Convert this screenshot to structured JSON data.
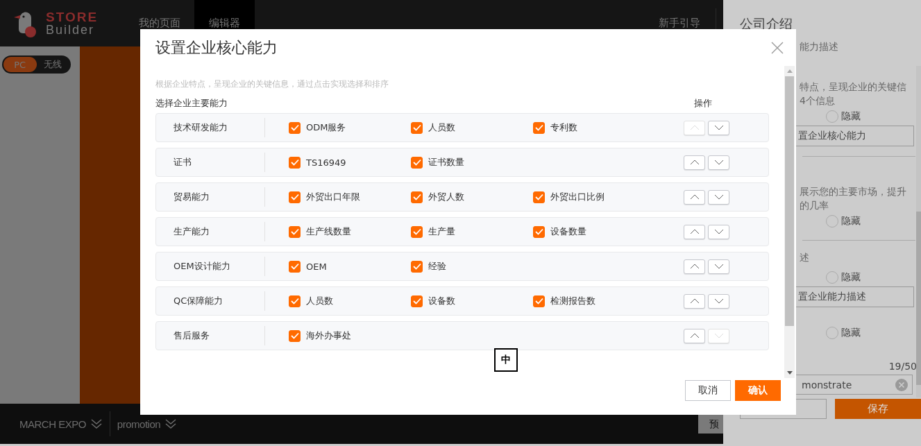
{
  "header": {
    "logo": {
      "line_1": "STORE",
      "line_2": "Builder"
    },
    "nav": [
      {
        "label": "我的页面",
        "selected": false
      },
      {
        "label": "编辑器",
        "selected": true
      }
    ],
    "guide": "新手引导"
  },
  "device_toggle": [
    {
      "label": "PC",
      "selected": true
    },
    {
      "label": "无线",
      "selected": false
    }
  ],
  "bottom_bar": {
    "menus": [
      "MARCH EXPO",
      "promotion"
    ],
    "preview_button": "预"
  },
  "side_panel": {
    "title": "公司介绍",
    "lines": [
      {
        "kind": "text",
        "text": "能力描述"
      },
      {
        "kind": "text",
        "text": "特点，呈现企业的关键信"
      },
      {
        "kind": "text",
        "text": "4个信息"
      },
      {
        "kind": "radio",
        "label": "隐藏",
        "checked": false
      },
      {
        "kind": "box",
        "text": "置企业核心能力"
      },
      {
        "kind": "divider"
      },
      {
        "kind": "text",
        "text": "展示您的主要市场，提升"
      },
      {
        "kind": "text",
        "text": "的几率"
      },
      {
        "kind": "radio",
        "label": "隐藏",
        "checked": false
      },
      {
        "kind": "divider"
      },
      {
        "kind": "text",
        "text": "述"
      },
      {
        "kind": "radio",
        "label": "隐藏",
        "checked": false
      },
      {
        "kind": "box",
        "text": "置企业能力描述"
      },
      {
        "kind": "radio",
        "label": "隐藏",
        "checked": false
      },
      {
        "kind": "counter",
        "text": "19/50"
      },
      {
        "kind": "input",
        "text": "monstrate"
      }
    ],
    "save_button": "保存"
  },
  "dialog": {
    "title": "设置企业核心能力",
    "hint": "根据企业特点，呈现企业的关键信息，通过点击实现选择和排序",
    "section_label": "选择企业主要能力",
    "actions_label": "操作",
    "rows": [
      {
        "name": "技术研发能力",
        "options": [
          {
            "label": "ODM服务",
            "checked": true
          },
          {
            "label": "人员数",
            "checked": true
          },
          {
            "label": "专利数",
            "checked": true
          }
        ],
        "up_disabled": true,
        "down_disabled": false
      },
      {
        "name": "证书",
        "options": [
          {
            "label": "TS16949",
            "checked": true
          },
          {
            "label": "证书数量",
            "checked": true
          }
        ],
        "up_disabled": false,
        "down_disabled": false
      },
      {
        "name": "贸易能力",
        "options": [
          {
            "label": "外贸出口年限",
            "checked": true
          },
          {
            "label": "外贸人数",
            "checked": true
          },
          {
            "label": "外贸出口比例",
            "checked": true
          }
        ],
        "up_disabled": false,
        "down_disabled": false
      },
      {
        "name": "生产能力",
        "options": [
          {
            "label": "生产线数量",
            "checked": true
          },
          {
            "label": "生产量",
            "checked": true
          },
          {
            "label": "设备数量",
            "checked": true
          }
        ],
        "up_disabled": false,
        "down_disabled": false
      },
      {
        "name": "OEM设计能力",
        "options": [
          {
            "label": "OEM",
            "checked": true
          },
          {
            "label": "经验",
            "checked": true
          }
        ],
        "up_disabled": false,
        "down_disabled": false
      },
      {
        "name": "QC保障能力",
        "options": [
          {
            "label": "人员数",
            "checked": true
          },
          {
            "label": "设备数",
            "checked": true
          },
          {
            "label": "检测报告数",
            "checked": true
          }
        ],
        "up_disabled": false,
        "down_disabled": false
      },
      {
        "name": "售后服务",
        "options": [
          {
            "label": "海外办事处",
            "checked": true
          }
        ],
        "up_disabled": false,
        "down_disabled": true
      }
    ],
    "buttons": [
      {
        "label": "取消",
        "kind": "secondary"
      },
      {
        "label": "确认",
        "kind": "primary"
      }
    ]
  },
  "ime_indicator": "中"
}
